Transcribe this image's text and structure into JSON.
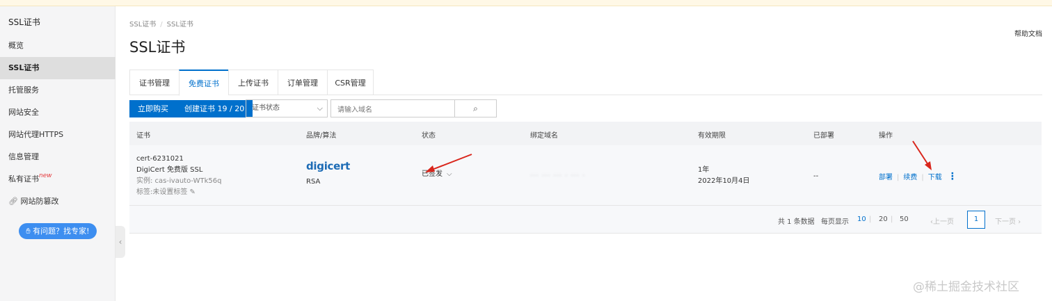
{
  "sidebar": {
    "title": "SSL证书",
    "items": [
      {
        "label": "概览"
      },
      {
        "label": "SSL证书"
      },
      {
        "label": "托管服务"
      },
      {
        "label": "网站安全"
      },
      {
        "label": "网站代理HTTPS"
      },
      {
        "label": "信息管理"
      },
      {
        "label": "私有证书",
        "badge": "new"
      },
      {
        "label": "网站防篡改"
      }
    ],
    "help_button": "有问题？找专家!"
  },
  "breadcrumb": [
    "SSL证书",
    "SSL证书"
  ],
  "help_doc": "帮助文档",
  "page_title": "SSL证书",
  "tabs": [
    "证书管理",
    "免费证书",
    "上传证书",
    "订单管理",
    "CSR管理"
  ],
  "toolbar": {
    "buy_label": "立即购买",
    "create_label": "创建证书 19 / 20",
    "status_select": "证书状态",
    "search_placeholder": "请输入域名"
  },
  "table": {
    "headers": [
      "证书",
      "品牌/算法",
      "状态",
      "绑定域名",
      "有效期限",
      "已部署",
      "操作"
    ],
    "row": {
      "cert_id": "cert-6231021",
      "cert_name": "DigiCert 免费版 SSL",
      "instance": "实例: cas-ivauto-WTk56q",
      "tag": "标签:未设置标签",
      "brand": "digicert",
      "algorithm": "RSA",
      "status": "已签发",
      "domain": "··· ··· ···  ·  ··· ·",
      "validity": "1年",
      "expiry": "2022年10月4日",
      "deployed": "--",
      "ops": [
        "部署",
        "续费",
        "下载"
      ]
    }
  },
  "pagination": {
    "total": "共 1 条数据",
    "per_page_label": "每页显示",
    "sizes": [
      "10",
      "20",
      "50"
    ],
    "prev": "上一页",
    "current": "1",
    "next": "下一页"
  },
  "colors": {
    "accent": "#0070cc",
    "arrow": "#d9261c"
  },
  "watermark": "@稀土掘金技术社区"
}
